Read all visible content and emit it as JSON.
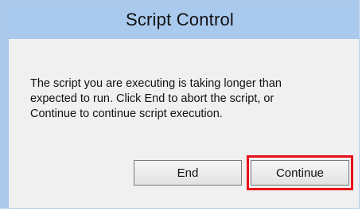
{
  "dialog": {
    "title": "Script Control",
    "message_lines": [
      "The script you are executing is taking longer than",
      "expected to run. Click End to abort the script, or",
      "Continue to continue script execution."
    ],
    "buttons": {
      "end_label": "End",
      "continue_label": "Continue"
    }
  },
  "colors": {
    "titlebar": "#a9c9ed",
    "body": "#f0f0f0",
    "highlight": "#e8101a"
  }
}
